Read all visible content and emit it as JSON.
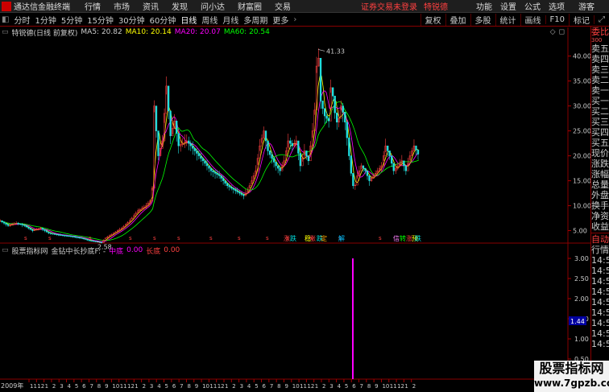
{
  "menubar": {
    "app_title": "通达信金融终端",
    "items": [
      "行情",
      "市场",
      "资讯",
      "发现",
      "问小达",
      "财富圈",
      "交易"
    ],
    "warning": "证券交易未登录",
    "stock_name": "特锐德",
    "right_items": [
      "功能",
      "设置",
      "公式",
      "选项"
    ],
    "guest": "游客"
  },
  "toolbar": {
    "periods": [
      "分时",
      "1分钟",
      "5分钟",
      "15分钟",
      "30分钟",
      "60分钟",
      "日线",
      "周线",
      "月线",
      "多周期",
      "更多"
    ],
    "active": "日线",
    "right_items": [
      "复权",
      "叠加",
      "多股",
      "统计",
      "画线",
      "F10",
      "标记"
    ]
  },
  "chart_header": {
    "security": "特锐德(日线 前复权)",
    "ma5_label": "MA5: 20.82",
    "ma10_label": "MA10: 20.14",
    "ma20_label": "MA20: 20.07",
    "ma60_label": "MA60: 20.54",
    "colors": {
      "ma5": "#ffffff",
      "ma10": "#ffff00",
      "ma20": "#ff00ff",
      "ma60": "#00ff00"
    }
  },
  "indicator_header": {
    "name": "股票指标网",
    "formula": "金钻中长抄底F: -",
    "zd_label": "中底",
    "zd_value": "0.00",
    "cd_label": "长底",
    "cd_value": "0.00"
  },
  "chart_data": [
    {
      "type": "candlestick",
      "ylim": [
        2.5,
        43.5
      ],
      "yticks": [
        "40.00",
        "35.00",
        "30.00",
        "25.00",
        "20.00",
        "15.00",
        "10.00",
        "5.00"
      ],
      "ytick_values": [
        40,
        35,
        30,
        25,
        20,
        15,
        10,
        5
      ],
      "annotations": [
        {
          "text": "41.33",
          "value": 41.33
        },
        {
          "text": "2.58",
          "value": 2.58
        }
      ],
      "price_path": [
        [
          0,
          7
        ],
        [
          10,
          6
        ],
        [
          20,
          6.5
        ],
        [
          30,
          6
        ],
        [
          40,
          5
        ],
        [
          50,
          5.5
        ],
        [
          60,
          4.5
        ],
        [
          70,
          4.2
        ],
        [
          80,
          4
        ],
        [
          90,
          3.8
        ],
        [
          100,
          3.5
        ],
        [
          110,
          3
        ],
        [
          120,
          2.8
        ],
        [
          125,
          2.6
        ],
        [
          130,
          3.5
        ],
        [
          140,
          4.5
        ],
        [
          150,
          5.5
        ],
        [
          160,
          7
        ],
        [
          170,
          9
        ],
        [
          180,
          10
        ],
        [
          185,
          11
        ],
        [
          188,
          14
        ],
        [
          190,
          30
        ],
        [
          195,
          20
        ],
        [
          200,
          23
        ],
        [
          205,
          34
        ],
        [
          210,
          24
        ],
        [
          215,
          27
        ],
        [
          220,
          22
        ],
        [
          230,
          23
        ],
        [
          240,
          21
        ],
        [
          250,
          19
        ],
        [
          260,
          17
        ],
        [
          270,
          16
        ],
        [
          280,
          14
        ],
        [
          290,
          13
        ],
        [
          300,
          12
        ],
        [
          305,
          13
        ],
        [
          310,
          15
        ],
        [
          315,
          17
        ],
        [
          320,
          22
        ],
        [
          325,
          25
        ],
        [
          330,
          21
        ],
        [
          340,
          18
        ],
        [
          345,
          17
        ],
        [
          350,
          19
        ],
        [
          355,
          23
        ],
        [
          360,
          22
        ],
        [
          365,
          23
        ],
        [
          370,
          18
        ],
        [
          375,
          21
        ],
        [
          380,
          19
        ],
        [
          385,
          25
        ],
        [
          388,
          30
        ],
        [
          390,
          38
        ],
        [
          392,
          41.3
        ],
        [
          395,
          31
        ],
        [
          400,
          28
        ],
        [
          405,
          27
        ],
        [
          408,
          35
        ],
        [
          412,
          29
        ],
        [
          416,
          26
        ],
        [
          420,
          30
        ],
        [
          424,
          28
        ],
        [
          428,
          23
        ],
        [
          432,
          17
        ],
        [
          436,
          13
        ],
        [
          440,
          16
        ],
        [
          445,
          18
        ],
        [
          450,
          17
        ],
        [
          455,
          15
        ],
        [
          460,
          16
        ],
        [
          465,
          17
        ],
        [
          470,
          18
        ],
        [
          475,
          22
        ],
        [
          480,
          20
        ],
        [
          485,
          17
        ],
        [
          490,
          18
        ],
        [
          495,
          19
        ],
        [
          500,
          17
        ],
        [
          505,
          20
        ],
        [
          510,
          22
        ],
        [
          516,
          20
        ]
      ],
      "event_tags": [
        "涨",
        "跌",
        "涨",
        "跌",
        "稳",
        "定",
        "解",
        "信",
        "转",
        "涨",
        "预",
        "跌"
      ]
    },
    {
      "type": "bar",
      "ylim": [
        0,
        3.1
      ],
      "yticks": [
        "3.00",
        "2.50",
        "2.00",
        "1.50",
        "1.00",
        "0.50"
      ],
      "ytick_values": [
        3,
        2.5,
        2,
        1.5,
        1,
        0.5
      ],
      "bar_value": 3.0,
      "cursor_value": "1.44"
    }
  ],
  "x_axis": {
    "first_label": "2009年",
    "labels": [
      "11",
      "12",
      "1",
      "2",
      "3",
      "4",
      "5",
      "6",
      "7",
      "8",
      "9",
      "10",
      "11",
      "12",
      "1",
      "2",
      "3",
      "4",
      "5",
      "6",
      "7",
      "8",
      "9",
      "10",
      "11",
      "12",
      "1",
      "2",
      "3",
      "4",
      "5",
      "6",
      "7",
      "8",
      "9",
      "10",
      "11",
      "12",
      "1",
      "2",
      "3",
      "4",
      "5",
      "6",
      "7",
      "8",
      "9",
      "10",
      "11",
      "12",
      "1",
      "2"
    ]
  },
  "right_panel": {
    "top_labels": [
      "委比",
      "卖五",
      "卖四",
      "卖三",
      "卖二",
      "卖一",
      "买一",
      "买二",
      "买三",
      "买四",
      "买五",
      "现价",
      "涨跌",
      "涨幅",
      "总量",
      "外盘",
      "换手",
      "净资",
      "收益"
    ],
    "bottom_labels": [
      "自动",
      "行情",
      "14:5",
      "14:5",
      "14:5",
      "14:5",
      "14:5",
      "14:5",
      "14:5",
      "14:5",
      "14:5"
    ],
    "price_small": "300"
  },
  "watermark": {
    "line1": "股票指标网",
    "line2": "www.7gpzb.com"
  }
}
